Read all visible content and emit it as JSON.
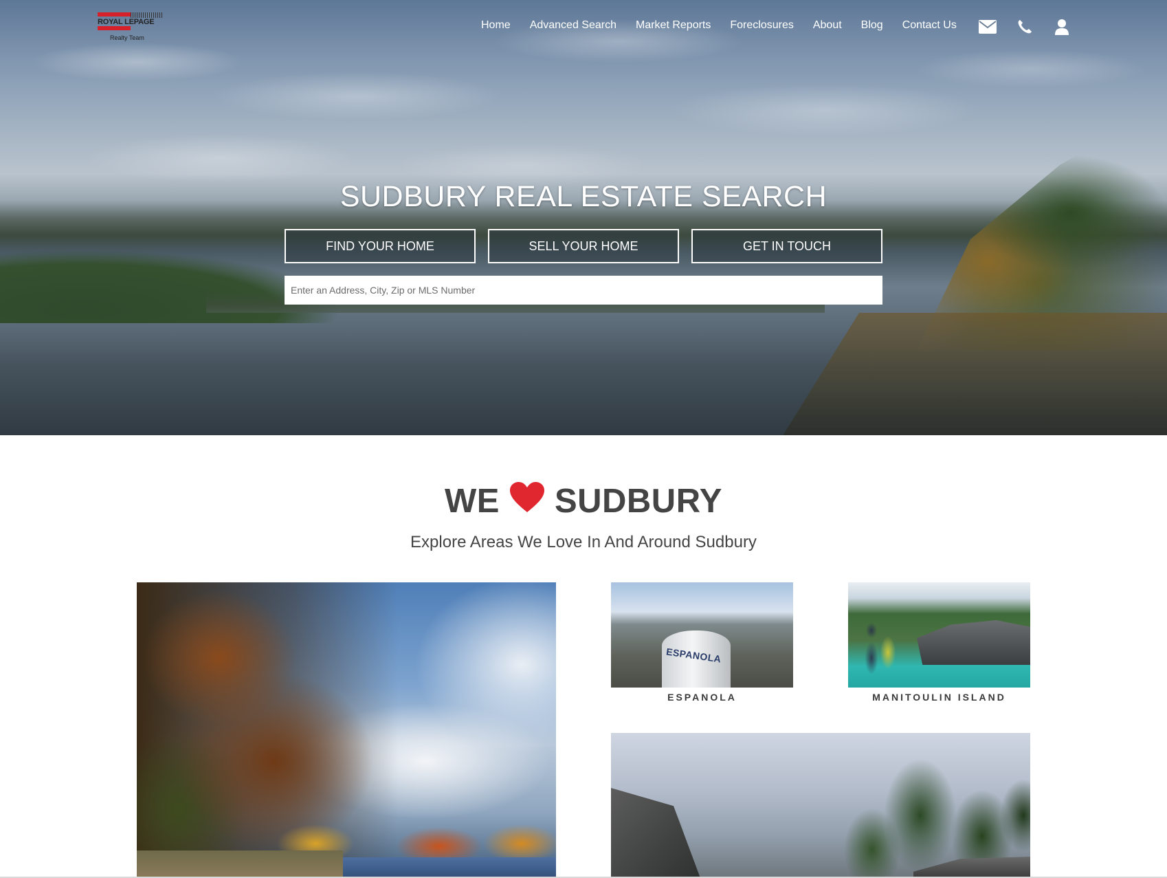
{
  "logo": {
    "brand": "ROYAL LEPAGE",
    "team": "Realty Team"
  },
  "nav": {
    "items": [
      "Home",
      "Advanced Search",
      "Market Reports",
      "Foreclosures",
      "About",
      "Blog",
      "Contact Us"
    ],
    "icons": [
      "envelope-icon",
      "phone-icon",
      "user-icon"
    ]
  },
  "hero": {
    "title": "SUDBURY REAL ESTATE SEARCH",
    "buttons": [
      "FIND YOUR HOME",
      "SELL YOUR HOME",
      "GET IN TOUCH"
    ],
    "search_placeholder": "Enter an Address, City, Zip or MLS Number",
    "search_value": ""
  },
  "love": {
    "title_left": "WE",
    "title_right": "SUDBURY",
    "heart_color": "#e0262e",
    "subtitle": "Explore Areas We Love In And Around Sudbury"
  },
  "areas": {
    "espanola": {
      "label": "ESPANOLA",
      "tower_text": "ESPANOLA"
    },
    "manitoulin": {
      "label": "MANITOULIN ISLAND"
    }
  }
}
